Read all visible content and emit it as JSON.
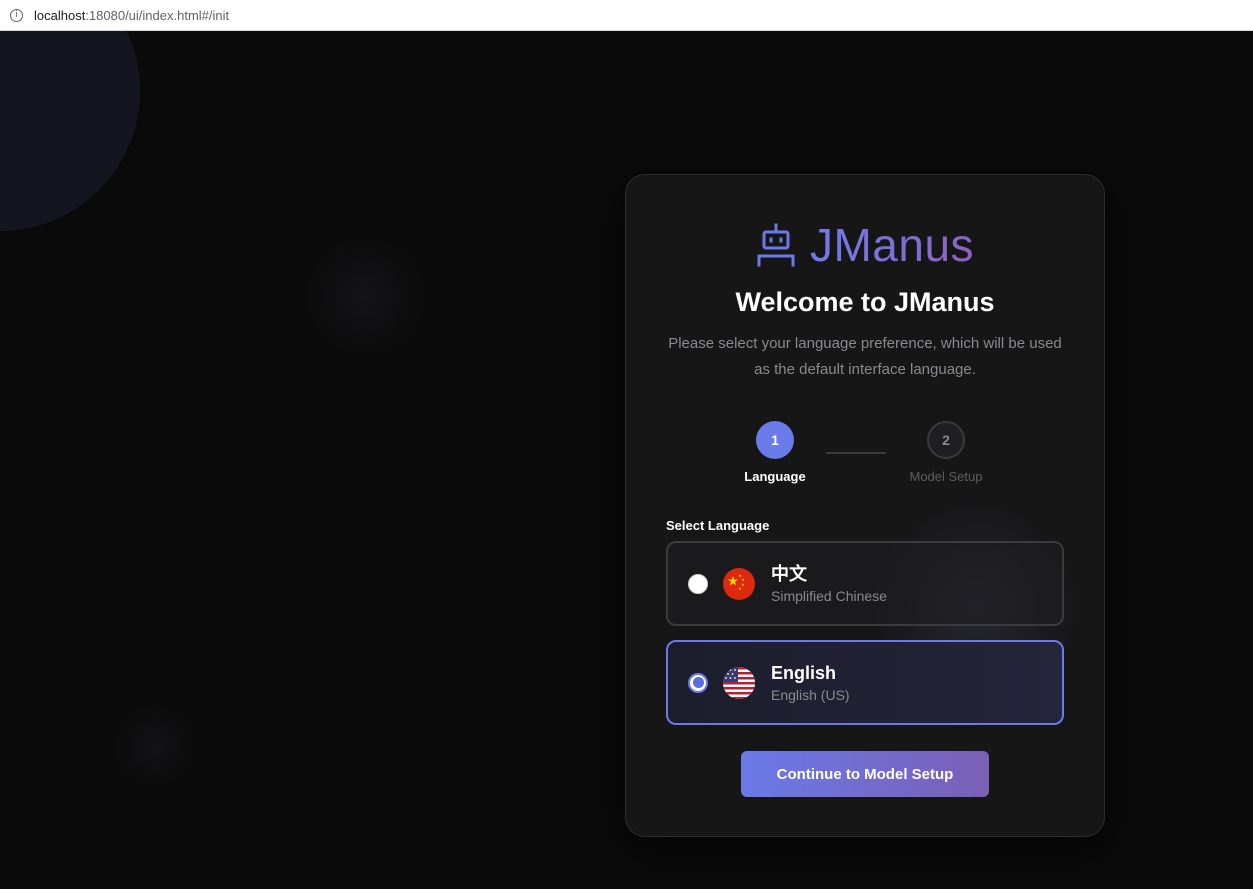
{
  "browser": {
    "info_icon": "info-icon",
    "url_host": "localhost",
    "url_rest": ":18080/ui/index.html#/init"
  },
  "logo": {
    "icon": "robot-icon",
    "text": "JManus",
    "gradient": [
      "#6f7be8",
      "#8c63c2"
    ]
  },
  "welcome": {
    "title": "Welcome to JManus",
    "description": "Please select your language preference, which will be used as the default interface language."
  },
  "steps": [
    {
      "number": "1",
      "label": "Language",
      "active": true
    },
    {
      "number": "2",
      "label": "Model Setup",
      "active": false
    }
  ],
  "language_select": {
    "label": "Select Language",
    "selected": "en",
    "options": [
      {
        "id": "zh",
        "name": "中文",
        "subtitle": "Simplified Chinese",
        "flag_icon": "china-flag-icon",
        "selected": false
      },
      {
        "id": "en",
        "name": "English",
        "subtitle": "English (US)",
        "flag_icon": "us-flag-icon",
        "selected": true
      }
    ]
  },
  "continue_button": {
    "label": "Continue to Model Setup"
  },
  "colors": {
    "accent": "#6a7ae8",
    "background": "#0a0a0a",
    "card": "#161617"
  }
}
